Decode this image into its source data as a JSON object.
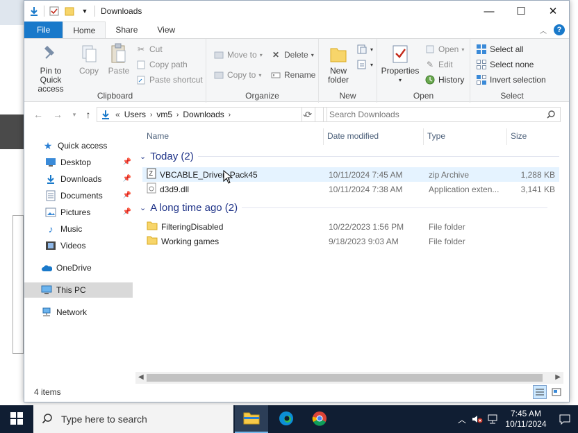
{
  "window": {
    "title": "Downloads",
    "controls": {
      "minimize": "—",
      "maximize": "☐",
      "close": "✕"
    }
  },
  "tabs": [
    {
      "label": "File"
    },
    {
      "label": "Home"
    },
    {
      "label": "Share"
    },
    {
      "label": "View"
    }
  ],
  "ribbon": {
    "clipboard": {
      "label": "Clipboard",
      "pin_line1": "Pin to Quick",
      "pin_line2": "access",
      "copy": "Copy",
      "paste": "Paste",
      "cut": "Cut",
      "copy_path": "Copy path",
      "paste_shortcut": "Paste shortcut"
    },
    "organize": {
      "label": "Organize",
      "move_to": "Move to",
      "copy_to": "Copy to",
      "delete": "Delete",
      "rename": "Rename"
    },
    "new": {
      "label": "New",
      "new_folder_line1": "New",
      "new_folder_line2": "folder"
    },
    "open": {
      "label": "Open",
      "properties": "Properties",
      "open": "Open",
      "edit": "Edit",
      "history": "History"
    },
    "select": {
      "label": "Select",
      "select_all": "Select all",
      "select_none": "Select none",
      "invert": "Invert selection"
    }
  },
  "address": {
    "crumbs": [
      "Users",
      "vm5",
      "Downloads"
    ],
    "prefix": "«",
    "search_placeholder": "Search Downloads"
  },
  "nav": {
    "quick_access": "Quick access",
    "items": [
      {
        "label": "Desktop",
        "pinned": true
      },
      {
        "label": "Downloads",
        "pinned": true
      },
      {
        "label": "Documents",
        "pinned": true
      },
      {
        "label": "Pictures",
        "pinned": true
      },
      {
        "label": "Music",
        "pinned": false
      },
      {
        "label": "Videos",
        "pinned": false
      }
    ],
    "onedrive": "OneDrive",
    "thispc": "This PC",
    "network": "Network"
  },
  "columns": {
    "name": "Name",
    "date": "Date modified",
    "type": "Type",
    "size": "Size"
  },
  "groups": [
    {
      "label": "Today (2)",
      "files": [
        {
          "name": "VBCABLE_Driver_Pack45",
          "date": "10/11/2024 7:45 AM",
          "type": "zip Archive",
          "size": "1,288 KB",
          "icon": "zip-icon"
        },
        {
          "name": "d3d9.dll",
          "date": "10/11/2024 7:38 AM",
          "type": "Application exten...",
          "size": "3,141 KB",
          "icon": "dll-icon"
        }
      ]
    },
    {
      "label": "A long time ago (2)",
      "files": [
        {
          "name": "FilteringDisabled",
          "date": "10/22/2023 1:56 PM",
          "type": "File folder",
          "size": "",
          "icon": "folder-icon"
        },
        {
          "name": "Working games",
          "date": "9/18/2023 9:03 AM",
          "type": "File folder",
          "size": "",
          "icon": "folder-icon"
        }
      ]
    }
  ],
  "status": {
    "count": "4 items"
  },
  "taskbar": {
    "search_placeholder": "Type here to search",
    "time": "7:45 AM",
    "date": "10/11/2024"
  },
  "colors": {
    "accent": "#1979ca",
    "group_header": "#1e3287",
    "taskbar": "#101e33",
    "hover": "#e5f3ff"
  }
}
